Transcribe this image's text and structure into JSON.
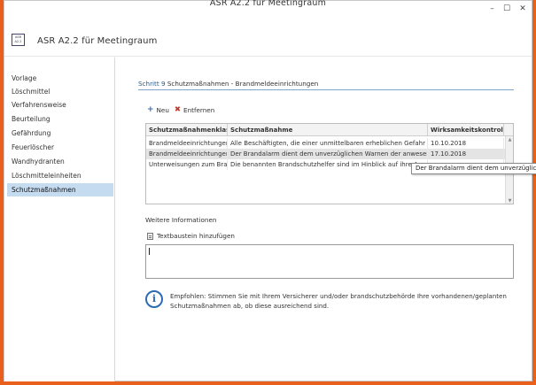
{
  "window": {
    "title": "ASR A2.2 für Meetingraum"
  },
  "app": {
    "icon_text_top": "ASR",
    "icon_text_bottom": "A2.2",
    "title": "ASR A2.2 für Meetingraum"
  },
  "sidebar": {
    "items": [
      {
        "label": "Vorlage"
      },
      {
        "label": "Löschmittel"
      },
      {
        "label": "Verfahrensweise"
      },
      {
        "label": "Beurteilung"
      },
      {
        "label": "Gefährdung"
      },
      {
        "label": "Feuerlöscher"
      },
      {
        "label": "Wandhydranten"
      },
      {
        "label": "Löschmitteleinheiten"
      },
      {
        "label": "Schutzmaßnahmen",
        "active": true
      }
    ]
  },
  "step": {
    "number_label": "Schritt 9",
    "title": "Schutzmaßnahmen - Brandmeldeeinrichtungen"
  },
  "toolbar": {
    "new_label": "Neu",
    "remove_label": "Entfernen"
  },
  "grid": {
    "columns": [
      "Schutzmaßnahmenklasse",
      "Schutzmaßnahme",
      "Wirksamkeitskontrolle"
    ],
    "rows": [
      [
        "Brandmeldeeinrichtungen",
        "Alle Beschäftigten, die einer unmittelbaren erheblichen Gefahr au...",
        "10.10.2018"
      ],
      [
        "Brandmeldeeinrichtungen",
        "Der Brandalarm dient dem unverzüglichen Warnen der anwesend...",
        "17.10.2018"
      ],
      [
        "Unterweisungen zum Bra...",
        "Die benannten Brandschutzhelfer sind im Hinblick auf ihre Au",
        ""
      ]
    ]
  },
  "tooltip": {
    "text": "Der Brandalarm dient dem unverzüglichen Warnen"
  },
  "details": {
    "section_label": "Weitere Informationen",
    "add_text_label": "Textbaustein hinzufügen",
    "notes_value": ""
  },
  "info": {
    "icon_glyph": "i",
    "line1": "Empfohlen: Stimmen Sie mit Ihrem Versicherer und/oder brandschutzbehörde Ihre vorhandenen/geplanten",
    "line2": "Schutzmaßnahmen ab, ob diese ausreichend sind."
  }
}
